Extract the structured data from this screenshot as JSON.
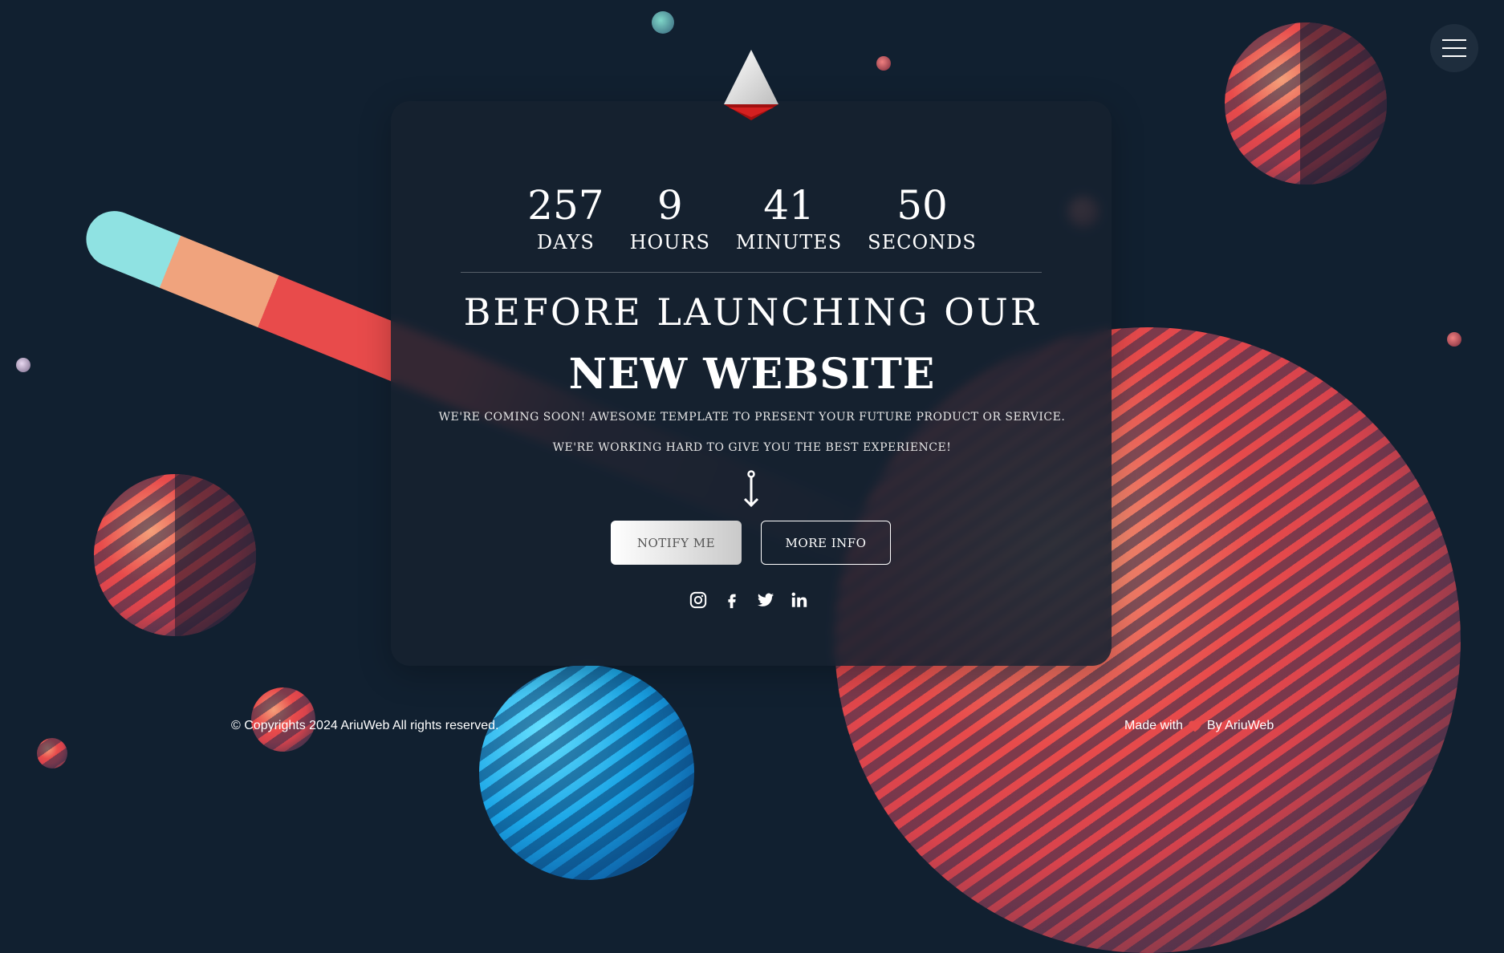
{
  "countdown": [
    {
      "value": "257",
      "label": "DAYS"
    },
    {
      "value": "9",
      "label": "HOURS"
    },
    {
      "value": "41",
      "label": "MINUTES"
    },
    {
      "value": "50",
      "label": "SECONDS"
    }
  ],
  "hero": {
    "title_line1": "BEFORE LAUNCHING OUR",
    "title_line2": "NEW WEBSITE",
    "subtitle1": "WE'RE COMING SOON! AWESOME TEMPLATE TO PRESENT YOUR FUTURE PRODUCT OR SERVICE.",
    "subtitle2": "WE'RE WORKING HARD TO GIVE YOU THE BEST EXPERIENCE!"
  },
  "buttons": {
    "notify_label": "NOTIFY ME",
    "more_info_label": "MORE INFO"
  },
  "social_icons": [
    "instagram-icon",
    "facebook-icon",
    "twitter-icon",
    "linkedin-icon"
  ],
  "footer": {
    "copyright": "© Copyrights 2024 AriuWeb All rights reserved.",
    "made_with": "Made with",
    "by": "By AriuWeb"
  },
  "colors": {
    "background": "#112030",
    "accent_red": "#e84b4b",
    "accent_cyan": "#8fe2e2"
  }
}
